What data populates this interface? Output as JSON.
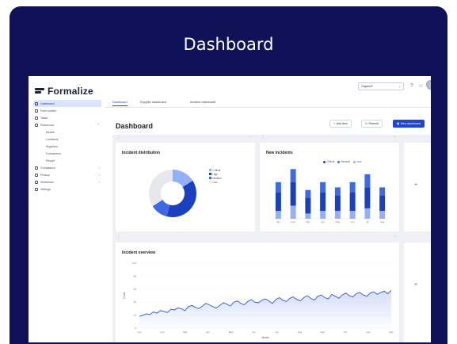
{
  "card": {
    "title": "Dashboard"
  },
  "brand": {
    "name": "Formalize"
  },
  "sidebar": {
    "items": [
      {
        "label": "Dashboard",
        "active": true,
        "sub": false,
        "icon": "grid-icon"
      },
      {
        "label": "Form builder",
        "active": false,
        "sub": false,
        "icon": "form-icon"
      },
      {
        "label": "Tasks",
        "active": false,
        "sub": false,
        "icon": "list-icon"
      },
      {
        "label": "Resources",
        "active": false,
        "sub": false,
        "icon": "folder-icon",
        "chevron": "⌃"
      },
      {
        "label": "Assets",
        "active": false,
        "sub": true
      },
      {
        "label": "Locations",
        "active": false,
        "sub": true
      },
      {
        "label": "Suppliers",
        "active": false,
        "sub": true
      },
      {
        "label": "Contractors",
        "active": false,
        "sub": true
      },
      {
        "label": "People",
        "active": false,
        "sub": true
      },
      {
        "label": "Compliance",
        "active": false,
        "sub": false,
        "icon": "shield-icon",
        "chevron": "›"
      },
      {
        "label": "Privacy",
        "active": false,
        "sub": false,
        "icon": "lock-icon",
        "chevron": "›"
      },
      {
        "label": "Workflows",
        "active": false,
        "sub": false,
        "icon": "flow-icon",
        "chevron": "›"
      },
      {
        "label": "Settings",
        "active": false,
        "sub": false,
        "icon": "gear-icon"
      }
    ]
  },
  "header": {
    "org_select": "Organs/F",
    "tabs": [
      "Dashboard",
      "Supplier dashboard",
      "Incident dashboard"
    ],
    "active_tab": 0
  },
  "page": {
    "title": "Dashboard",
    "buttons": {
      "add": "Add item",
      "refresh": "Refresh",
      "primary": "New dashboard"
    }
  },
  "colors": {
    "card_bg": "#0f1257",
    "accent": "#1f45d6",
    "dark_blue": "#1a3fc1",
    "mid_blue": "#3d68e6",
    "light_blue": "#94b0f8",
    "grey": "#e6e8ee"
  },
  "panels": {
    "incident_distribution": {
      "title": "Incident distribution"
    },
    "new_incidents": {
      "title": "New incidents"
    },
    "incident_overview": {
      "title": "Incident overview"
    }
  },
  "chart_data": [
    {
      "type": "pie",
      "title": "Incident distribution",
      "labels": [
        "Critical",
        "High",
        "Medium",
        "Low"
      ],
      "values": [
        16,
        38,
        12,
        34
      ]
    },
    {
      "type": "bar",
      "title": "New incidents",
      "categories": [
        "Jan",
        "Feb",
        "Mar",
        "Apr",
        "May",
        "Jun",
        "Jul",
        "Aug"
      ],
      "series": [
        {
          "name": "Critical",
          "values": [
            14,
            18,
            12,
            14,
            12,
            14,
            16,
            12
          ]
        },
        {
          "name": "Medium",
          "values": [
            8,
            10,
            6,
            8,
            6,
            8,
            10,
            6
          ]
        },
        {
          "name": "Low",
          "values": [
            6,
            10,
            4,
            6,
            6,
            6,
            8,
            6
          ]
        }
      ],
      "ylim": [
        0,
        40
      ]
    },
    {
      "type": "area",
      "title": "Incident overview",
      "ylabel": "Count",
      "xlabel": "Month",
      "categories": [
        "Jan",
        "Feb",
        "Mar",
        "Apr",
        "May",
        "Jun",
        "Jul",
        "Aug",
        "Sep",
        "Oct",
        "Nov",
        "Dec"
      ],
      "x": [
        0,
        1,
        2,
        3,
        4,
        5,
        6,
        7,
        8,
        9,
        10,
        11,
        12,
        13,
        14,
        15,
        16,
        17,
        18,
        19,
        20,
        21,
        22,
        23,
        24,
        25,
        26,
        27,
        28,
        29,
        30,
        31,
        32,
        33,
        34,
        35,
        36,
        37,
        38,
        39,
        40,
        41,
        42,
        43,
        44,
        45,
        46,
        47,
        48,
        49,
        50,
        51,
        52,
        53,
        54,
        55,
        56,
        57,
        58,
        59,
        60,
        61,
        62,
        63,
        64,
        65,
        66,
        67,
        68,
        69,
        70,
        71,
        72
      ],
      "values": [
        18,
        20,
        22,
        21,
        25,
        23,
        27,
        26,
        24,
        29,
        28,
        31,
        30,
        27,
        33,
        35,
        32,
        30,
        34,
        38,
        36,
        33,
        31,
        35,
        39,
        37,
        34,
        40,
        42,
        38,
        36,
        41,
        44,
        40,
        39,
        43,
        45,
        42,
        38,
        44,
        47,
        43,
        41,
        46,
        48,
        44,
        42,
        47,
        50,
        46,
        43,
        49,
        51,
        47,
        45,
        52,
        49,
        46,
        51,
        54,
        50,
        48,
        53,
        55,
        51,
        49,
        54,
        56,
        52,
        55,
        57,
        53,
        58
      ],
      "yticks": [
        "100",
        "80",
        "60",
        "40",
        "20",
        "0"
      ],
      "ylim": [
        0,
        100
      ]
    }
  ]
}
